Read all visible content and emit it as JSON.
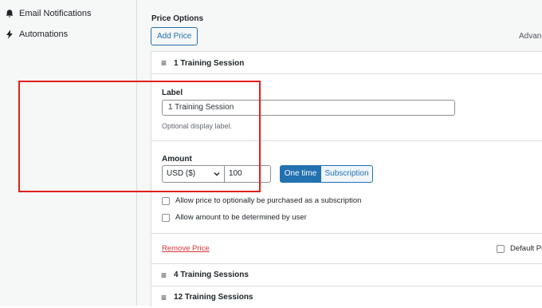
{
  "sidebar": {
    "items": [
      {
        "label": "Email Notifications",
        "icon": "bell-icon"
      },
      {
        "label": "Automations",
        "icon": "bolt-icon"
      }
    ]
  },
  "main": {
    "section_title": "Price Options",
    "add_price_label": "Add Price",
    "advanced_label": "Advanc",
    "prices": [
      {
        "title": "1 Training Session",
        "label_heading": "Label",
        "label_value": "1 Training Session",
        "label_help": "Optional display label.",
        "amount_heading": "Amount",
        "currency": "USD ($)",
        "amount": "100",
        "mode_one_time": "One time",
        "mode_subscription": "Subscription",
        "options": [
          "Allow price to optionally be purchased as a subscription",
          "Allow amount to be determined by user"
        ],
        "remove_label": "Remove Price",
        "default_label": "Default Pr"
      },
      {
        "title": "4 Training Sessions"
      },
      {
        "title": "12 Training Sessions"
      }
    ]
  },
  "colors": {
    "accent": "#2271b1",
    "danger": "#d63638",
    "highlight": "#e0201d"
  }
}
